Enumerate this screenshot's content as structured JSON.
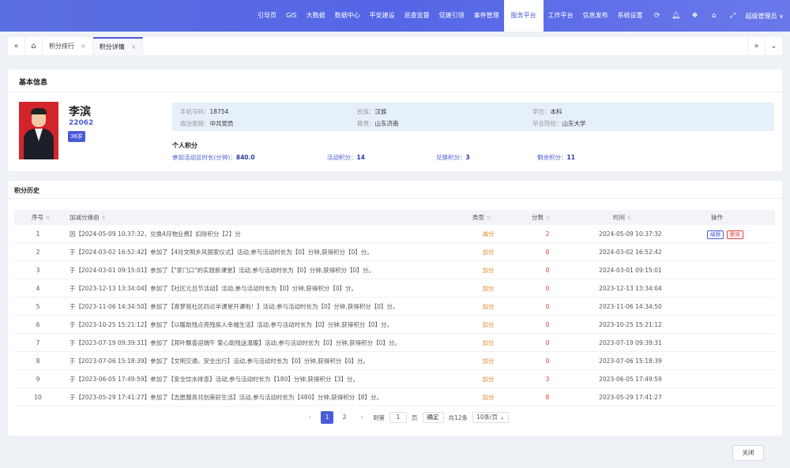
{
  "header": {
    "nav": [
      "引导页",
      "GIS",
      "大数据",
      "数据中心",
      "平安建设",
      "巡查监督",
      "党建引领",
      "事件管理",
      "服务平台",
      "工作平台",
      "信息发布",
      "系统设置"
    ],
    "active_nav": "服务平台",
    "user_label": "超级管理员 ∨",
    "icons": [
      "refresh-icon",
      "bell-icon",
      "skin-icon",
      "tag-icon",
      "fullscreen-icon"
    ]
  },
  "tabs": {
    "items": [
      {
        "label": "积分排行",
        "active": false
      },
      {
        "label": "积分详情",
        "active": true
      }
    ]
  },
  "basic_info": {
    "title": "基本信息",
    "name": "李滨",
    "code": "22062",
    "age": "36岁",
    "fields": {
      "phone": {
        "label": "手机号码：",
        "value": "18754"
      },
      "ethnic": {
        "label": "民族：",
        "value": "汉族"
      },
      "education": {
        "label": "学历：",
        "value": "本科"
      },
      "political": {
        "label": "政治面貌：",
        "value": "中共党员"
      },
      "origin": {
        "label": "籍贯：",
        "value": "山东济南"
      },
      "school": {
        "label": "毕业院校：",
        "value": "山东大学"
      }
    },
    "score_title": "个人积分",
    "scores": {
      "duration": {
        "label": "参加活动总时长(分钟)：",
        "value": "840.0"
      },
      "activity": {
        "label": "活动积分：",
        "value": "14"
      },
      "exchange": {
        "label": "兑换积分：",
        "value": "3"
      },
      "remaining": {
        "label": "剩余积分：",
        "value": "11"
      }
    }
  },
  "history": {
    "title": "积分历史",
    "columns": {
      "index": "序号",
      "reason": "加减分缘由",
      "type": "类型",
      "points": "分数",
      "time": "时间",
      "ops": "操作"
    },
    "rows": [
      {
        "index": "1",
        "reason": "因【2024-05-09 10:37:32，兑换4月物业费】扣除积分【2】分",
        "type": "减分",
        "points": "2",
        "time": "2024-05-09 10:37:32",
        "ops": true
      },
      {
        "index": "2",
        "reason": "于【2024-03-02 16:52:42】参加了【4月文明乡风国家仪式】活动,参与活动时长为【0】分钟,获得积分【0】分。",
        "type": "加分",
        "points": "0",
        "time": "2024-03-02 16:52:42",
        "ops": false
      },
      {
        "index": "3",
        "reason": "于【2024-03-01 09:15:01】参加了【\"家门口\"的实践新课堂】活动,参与活动时长为【0】分钟,获得积分【0】分。",
        "type": "加分",
        "points": "0",
        "time": "2024-03-01 09:15:01",
        "ops": false
      },
      {
        "index": "4",
        "reason": "于【2023-12-13 13:34:04】参加了【社区元旦节活动】活动,参与活动时长为【0】分钟,获得积分【0】分。",
        "type": "加分",
        "points": "0",
        "time": "2023-12-13 13:34:04",
        "ops": false
      },
      {
        "index": "5",
        "reason": "于【2023-11-06 14:34:50】参加了【青梦苑社区四点半课堂开课啦！】活动,参与活动时长为【0】分钟,获得积分【0】分。",
        "type": "加分",
        "points": "0",
        "time": "2023-11-06 14:34:50",
        "ops": false
      },
      {
        "index": "6",
        "reason": "于【2023-10-25 15:21:12】参加了【以暖助残点亮残疾人幸福生活】活动,参与活动时长为【0】分钟,获得积分【0】分。",
        "type": "加分",
        "points": "0",
        "time": "2023-10-25 15:21:12",
        "ops": false
      },
      {
        "index": "7",
        "reason": "于【2023-07-19 09:39:31】参加了【邦叶飘香迎端午 爱心助残送温暖】活动,参与活动时长为【0】分钟,获得积分【0】分。",
        "type": "加分",
        "points": "0",
        "time": "2023-07-19 09:39:31",
        "ops": false
      },
      {
        "index": "8",
        "reason": "于【2023-07-06 15:18:39】参加了【文明交通，安全出行】活动,参与活动时长为【0】分钟,获得积分【0】分。",
        "type": "加分",
        "points": "0",
        "time": "2023-07-06 15:18:39",
        "ops": false
      },
      {
        "index": "9",
        "reason": "于【2023-06-05 17:49:59】参加了【安全饮水排查】活动,参与活动时长为【180】分钟,获得积分【3】分。",
        "type": "加分",
        "points": "3",
        "time": "2023-06-05 17:49:59",
        "ops": false
      },
      {
        "index": "10",
        "reason": "于【2023-05-29 17:41:27】参加了【志愿服务共创美好生活】活动,参与活动时长为【480】分钟,获得积分【8】分。",
        "type": "加分",
        "points": "8",
        "time": "2023-05-29 17:41:27",
        "ops": false
      }
    ],
    "ops_labels": {
      "edit": "编辑",
      "delete": "删除"
    },
    "pager": {
      "pages": [
        "1",
        "2"
      ],
      "goto_label": "到第",
      "goto_value": "1",
      "page_unit": "页",
      "confirm": "确定",
      "total": "共12条",
      "page_size": "10条/页 ⌄"
    }
  },
  "footer": {
    "close_label": "关闭"
  }
}
